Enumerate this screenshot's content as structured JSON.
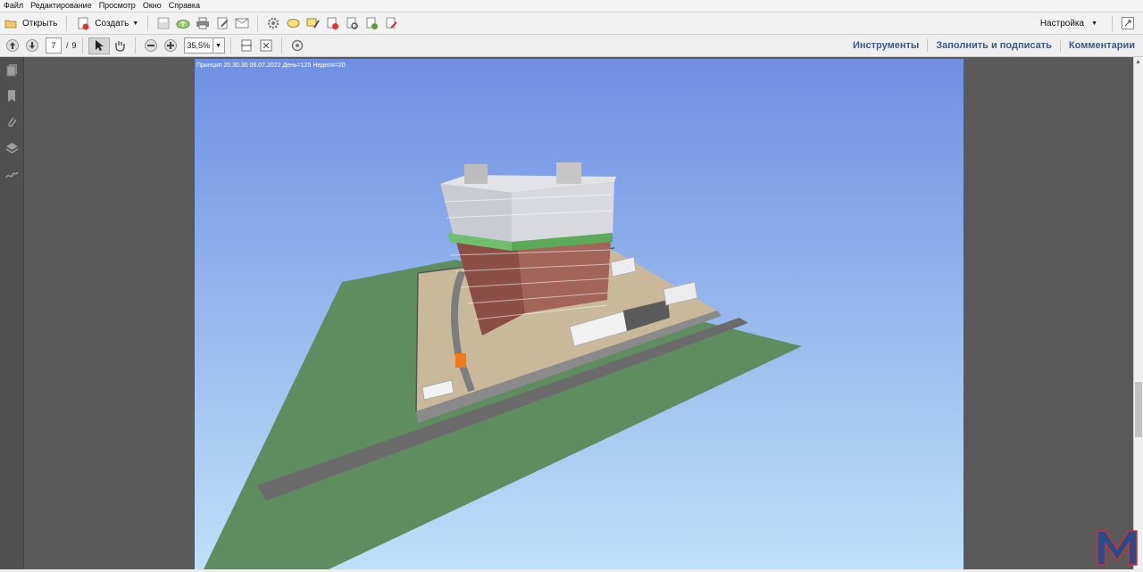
{
  "menu": [
    "Файл",
    "Редактирование",
    "Просмотр",
    "Окно",
    "Справка"
  ],
  "toolbar": {
    "open_label": "Открыть",
    "create_label": "Создать",
    "settings_label": "Настройка"
  },
  "navigation": {
    "current_page": "7",
    "page_separator": "/",
    "total_pages": "9",
    "zoom": "35,5%"
  },
  "panels": {
    "tools": "Инструменты",
    "fill_sign": "Заполнить и подписать",
    "comments": "Комментарии"
  },
  "document": {
    "overlay_text": "Принцип 20.30.30 06.07.2022 День=125 Неделя=20"
  },
  "colors": {
    "sky_top": "#6e8fe3",
    "sky_bottom": "#bfe0f8",
    "ground": "#5f8d5f",
    "road": "#6b6b6b",
    "site": "#c9b89a"
  }
}
